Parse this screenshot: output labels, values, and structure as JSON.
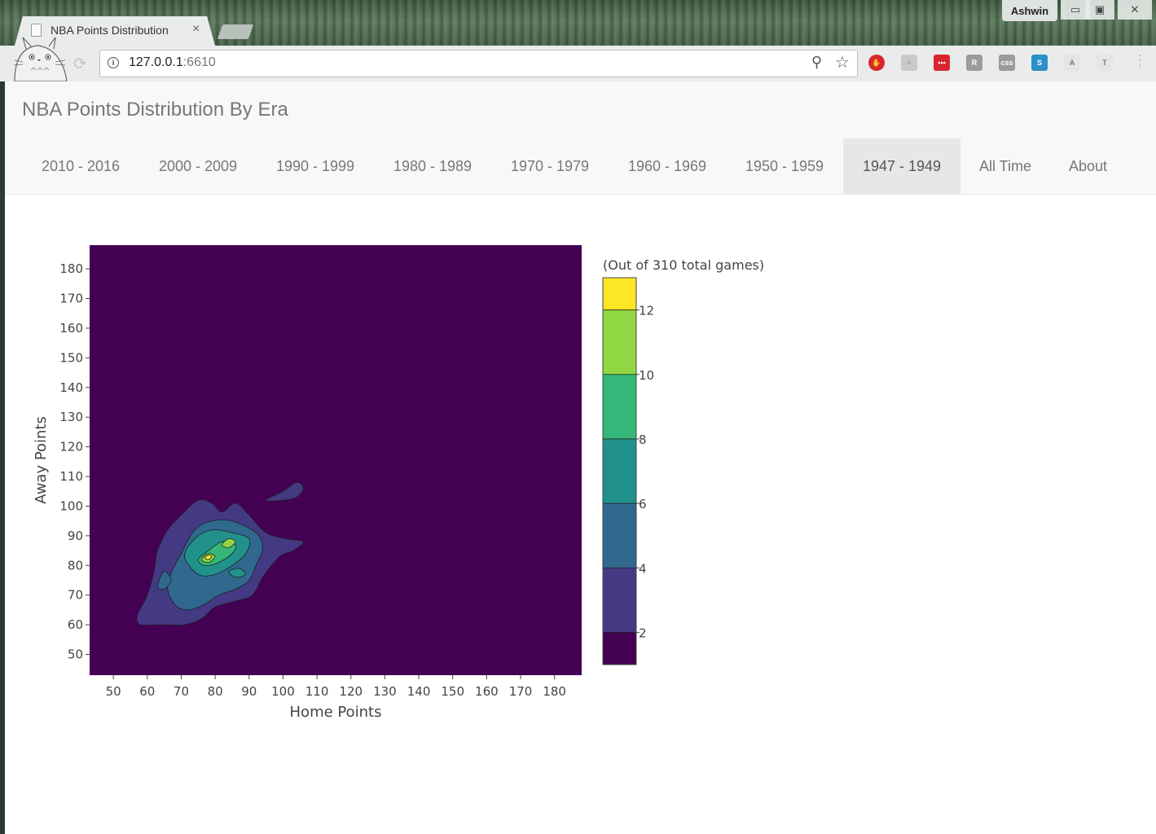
{
  "browser": {
    "tab_title": "NBA Points Distribution",
    "tab_close": "×",
    "user_name": "Ashwin",
    "url_host": "127.0.0.1",
    "url_port": ":6610",
    "window_controls": {
      "minimize": "▭",
      "maximize": "▣",
      "close": "✕"
    }
  },
  "navbar": {
    "brand": "NBA Points Distribution By Era",
    "items": [
      {
        "label": "2010 - 2016"
      },
      {
        "label": "2000 - 2009"
      },
      {
        "label": "1990 - 1999"
      },
      {
        "label": "1980 - 1989"
      },
      {
        "label": "1970 - 1979"
      },
      {
        "label": "1960 - 1969"
      },
      {
        "label": "1950 - 1959"
      },
      {
        "label": "1947 - 1949"
      },
      {
        "label": "All Time"
      },
      {
        "label": "About"
      }
    ],
    "active_index": 7
  },
  "chart_data": {
    "type": "contour",
    "xlabel": "Home Points",
    "ylabel": "Away Points",
    "xlim": [
      43,
      188
    ],
    "ylim": [
      43,
      188
    ],
    "xticks": [
      50,
      60,
      70,
      80,
      90,
      100,
      110,
      120,
      130,
      140,
      150,
      160,
      170,
      180
    ],
    "yticks": [
      50,
      60,
      70,
      80,
      90,
      100,
      110,
      120,
      130,
      140,
      150,
      160,
      170,
      180
    ],
    "colorbar": {
      "title": "(Out of  310  total games)",
      "ticks": [
        2,
        4,
        6,
        8,
        10,
        12
      ],
      "range": [
        1,
        13
      ],
      "colors": [
        "#440154",
        "#443a83",
        "#31688e",
        "#21918c",
        "#35b779",
        "#90d743",
        "#fde725"
      ]
    },
    "contours": [
      {
        "level": 2,
        "color": "#443a83",
        "points": [
          [
            57,
            63
          ],
          [
            60,
            70
          ],
          [
            62,
            78
          ],
          [
            63,
            85
          ],
          [
            66,
            92
          ],
          [
            70,
            97
          ],
          [
            75,
            102
          ],
          [
            79,
            101
          ],
          [
            82,
            98
          ],
          [
            86,
            101
          ],
          [
            90,
            97
          ],
          [
            95,
            91
          ],
          [
            101,
            89
          ],
          [
            106,
            88
          ],
          [
            103,
            85
          ],
          [
            99,
            83
          ],
          [
            94,
            76
          ],
          [
            91,
            70
          ],
          [
            86,
            68
          ],
          [
            80,
            66
          ],
          [
            76,
            62
          ],
          [
            71,
            60
          ],
          [
            67,
            60
          ],
          [
            62,
            60
          ],
          [
            58,
            60
          ]
        ]
      },
      {
        "level": 2,
        "color": "#443a83",
        "points": [
          [
            95,
            102
          ],
          [
            100,
            105
          ],
          [
            104,
            108
          ],
          [
            106,
            106
          ],
          [
            104,
            103
          ],
          [
            100,
            102
          ]
        ]
      },
      {
        "level": 4,
        "color": "#31688e",
        "points": [
          [
            66,
            74
          ],
          [
            70,
            84
          ],
          [
            74,
            92
          ],
          [
            79,
            95
          ],
          [
            85,
            95
          ],
          [
            92,
            91
          ],
          [
            94,
            86
          ],
          [
            92,
            80
          ],
          [
            90,
            75
          ],
          [
            86,
            72
          ],
          [
            81,
            70
          ],
          [
            77,
            67
          ],
          [
            72,
            65
          ],
          [
            68,
            67
          ]
        ]
      },
      {
        "level": 4,
        "color": "#31688e",
        "points": [
          [
            63,
            73
          ],
          [
            65,
            78
          ],
          [
            67,
            75
          ],
          [
            65,
            72
          ]
        ]
      },
      {
        "level": 6,
        "color": "#21918c",
        "points": [
          [
            71,
            83
          ],
          [
            74,
            89
          ],
          [
            79,
            92
          ],
          [
            85,
            91
          ],
          [
            90,
            89
          ],
          [
            89,
            84
          ],
          [
            85,
            80
          ],
          [
            80,
            77
          ],
          [
            75,
            77
          ]
        ]
      },
      {
        "level": 6,
        "color": "#21918c",
        "points": [
          [
            84,
            78
          ],
          [
            87,
            79
          ],
          [
            89,
            77
          ],
          [
            86,
            76
          ]
        ]
      },
      {
        "level": 8,
        "color": "#35b779",
        "points": [
          [
            75,
            82
          ],
          [
            78,
            85
          ],
          [
            82,
            88
          ],
          [
            86,
            87
          ],
          [
            85,
            84
          ],
          [
            81,
            81
          ],
          [
            77,
            80
          ]
        ]
      },
      {
        "level": 10,
        "color": "#90d743",
        "points": [
          [
            76,
            82
          ],
          [
            78,
            84
          ],
          [
            80,
            83
          ],
          [
            78,
            81
          ]
        ]
      },
      {
        "level": 10,
        "color": "#90d743",
        "points": [
          [
            82,
            87
          ],
          [
            84,
            89
          ],
          [
            86,
            88
          ],
          [
            84,
            86
          ]
        ]
      },
      {
        "level": 12,
        "color": "#fde725",
        "points": [
          [
            77,
            82.5
          ],
          [
            78,
            83.5
          ],
          [
            79,
            83
          ],
          [
            78,
            82
          ]
        ]
      }
    ]
  }
}
